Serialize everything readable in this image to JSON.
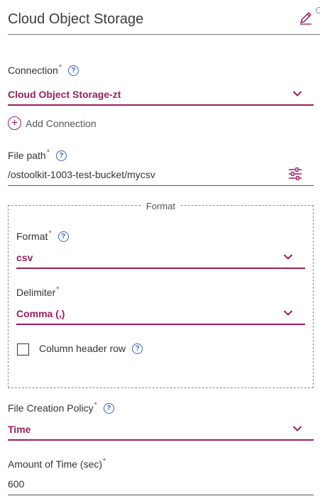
{
  "header": {
    "title": "Cloud Object Storage"
  },
  "connection": {
    "label": "Connection",
    "required": "*",
    "help": "?",
    "value": "Cloud Object Storage-zt",
    "add_label": "Add Connection"
  },
  "file_path": {
    "label": "File path",
    "required": "*",
    "help": "?",
    "value": "/ostoolkit-1003-test-bucket/mycsv"
  },
  "format_group": {
    "legend": "Format",
    "format": {
      "label": "Format",
      "required": "*",
      "help": "?",
      "value": "csv"
    },
    "delimiter": {
      "label": "Delimiter",
      "required": "*",
      "value": "Comma (,)"
    },
    "header_row": {
      "label": "Column header row",
      "help": "?",
      "checked": false
    }
  },
  "file_creation_policy": {
    "label": "File Creation Policy",
    "required": "*",
    "help": "?",
    "value": "Time"
  },
  "amount_of_time": {
    "label": "Amount of Time (sec)",
    "required": "*",
    "value": "600"
  },
  "colors": {
    "accent": "#9b1d5e",
    "help": "#3b5fc0",
    "required": "#c0385b"
  },
  "icons": [
    "edit-icon",
    "help-icon",
    "chevron-down-icon",
    "add-icon",
    "settings-sliders-icon"
  ]
}
